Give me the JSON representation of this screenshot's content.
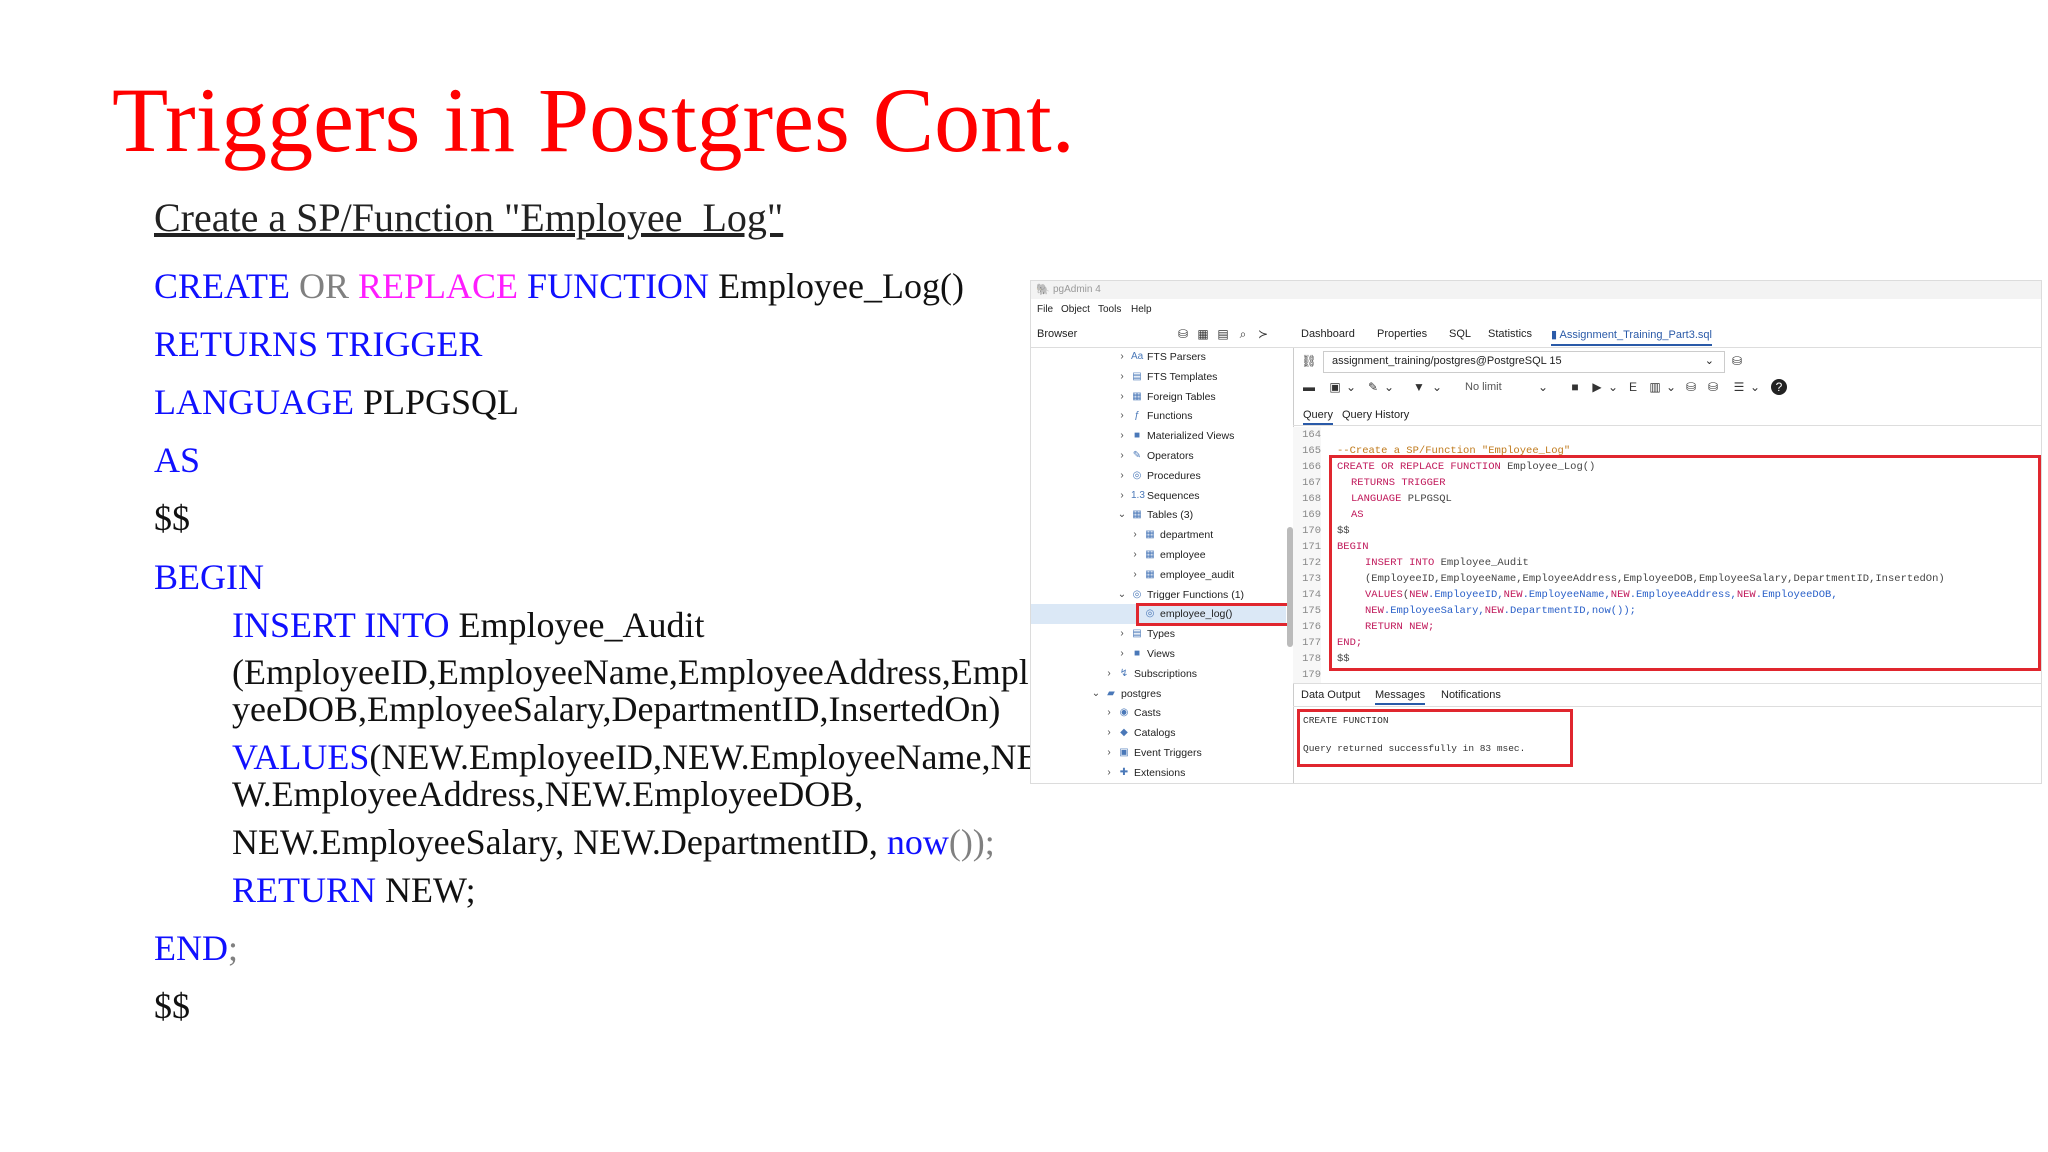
{
  "slide": {
    "title": "Triggers in Postgres Cont.",
    "subtitle": "Create a SP/Function \"Employee_Log\"",
    "code": {
      "l1_create": "CREATE",
      "l1_or": "OR",
      "l1_replace": "REPLACE",
      "l1_function": "FUNCTION",
      "l1_name": "Employee_Log()",
      "l2": "RETURNS TRIGGER",
      "l3_kw": "LANGUAGE",
      "l3_val": "PLPGSQL",
      "l4": "AS",
      "l5": "$$",
      "l6": "BEGIN",
      "l7_kw": "INSERT INTO",
      "l7_name": "Employee_Audit",
      "l8a": "(EmployeeID,EmployeeName,EmployeeAddress,Emplo",
      "l8b": "yeeDOB,EmployeeSalary,DepartmentID,InsertedOn)",
      "l9_kw": "VALUES",
      "l9_rest": "(NEW.EmployeeID,NEW.EmployeeName,NE",
      "l10": "W.EmployeeAddress,NEW.EmployeeDOB,",
      "l11_a": "NEW.EmployeeSalary, NEW.DepartmentID, ",
      "l11_now": "now",
      "l11_b": "());",
      "l12_kw": "RETURN",
      "l12_rest": "NEW;",
      "l13_kw": "END",
      "l13_semi": ";",
      "l14": "$$"
    }
  },
  "pgadmin": {
    "window_title": "pgAdmin 4",
    "menu": [
      "File",
      "Object",
      "Tools",
      "Help"
    ],
    "browser_label": "Browser",
    "tabs": [
      "Dashboard",
      "Properties",
      "SQL",
      "Statistics",
      "Assignment_Training_Part3.sql"
    ],
    "connection": "assignment_training/postgres@PostgreSQL 15",
    "toolbar_limit": "No limit",
    "query_tabs": [
      "Query",
      "Query History"
    ],
    "output_tabs": [
      "Data Output",
      "Messages",
      "Notifications"
    ],
    "tree": [
      {
        "label": "FTS Parsers",
        "icon": "Aa",
        "chev": "›",
        "indent": 0
      },
      {
        "label": "FTS Templates",
        "icon": "▤",
        "chev": "›",
        "indent": 0
      },
      {
        "label": "Foreign Tables",
        "icon": "▦",
        "chev": "›",
        "indent": 0
      },
      {
        "label": "Functions",
        "icon": "ƒ",
        "chev": "›",
        "indent": 0
      },
      {
        "label": "Materialized Views",
        "icon": "■",
        "chev": "›",
        "indent": 0
      },
      {
        "label": "Operators",
        "icon": "✎",
        "chev": "›",
        "indent": 0
      },
      {
        "label": "Procedures",
        "icon": "◎",
        "chev": "›",
        "indent": 0
      },
      {
        "label": "Sequences",
        "icon": "1.3",
        "chev": "›",
        "indent": 0
      },
      {
        "label": "Tables (3)",
        "icon": "▦",
        "chev": "⌄",
        "indent": 0
      },
      {
        "label": "department",
        "icon": "▦",
        "chev": "›",
        "indent": 1
      },
      {
        "label": "employee",
        "icon": "▦",
        "chev": "›",
        "indent": 1
      },
      {
        "label": "employee_audit",
        "icon": "▦",
        "chev": "›",
        "indent": 1
      },
      {
        "label": "Trigger Functions (1)",
        "icon": "◎",
        "chev": "⌄",
        "indent": 0
      },
      {
        "label": "employee_log()",
        "icon": "◎",
        "chev": "",
        "indent": 1
      },
      {
        "label": "Types",
        "icon": "▤",
        "chev": "›",
        "indent": 0
      },
      {
        "label": "Views",
        "icon": "■",
        "chev": "›",
        "indent": 0
      },
      {
        "label": "Subscriptions",
        "icon": "↯",
        "chev": "›",
        "indent": -1
      },
      {
        "label": "postgres",
        "icon": "▰",
        "chev": "⌄",
        "indent": -2
      },
      {
        "label": "Casts",
        "icon": "◉",
        "chev": "›",
        "indent": -1
      },
      {
        "label": "Catalogs",
        "icon": "◆",
        "chev": "›",
        "indent": -1
      },
      {
        "label": "Event Triggers",
        "icon": "▣",
        "chev": "›",
        "indent": -1
      },
      {
        "label": "Extensions",
        "icon": "✚",
        "chev": "›",
        "indent": -1
      }
    ],
    "editor": {
      "line_numbers": [
        "164",
        "165",
        "166",
        "167",
        "168",
        "169",
        "170",
        "171",
        "172",
        "173",
        "174",
        "175",
        "176",
        "177",
        "178",
        "179"
      ],
      "comment": "--Create a SP/Function \"Employee_Log\"",
      "c166_kw": "CREATE OR REPLACE FUNCTION",
      "c166_name": " Employee_Log()",
      "c167": "RETURNS TRIGGER",
      "c168_kw": "LANGUAGE",
      "c168_val": " PLPGSQL",
      "c169": "AS",
      "c170": "$$",
      "c171": "BEGIN",
      "c172_kw": "INSERT INTO",
      "c172_name": " Employee_Audit",
      "c173": "(EmployeeID,EmployeeName,EmployeeAddress,EmployeeDOB,EmployeeSalary,DepartmentID,InsertedOn)",
      "c174_values": "VALUES",
      "c174_paren": "(",
      "c174_n1": "NEW",
      "c174_f1": ".EmployeeID,",
      "c174_n2": "NEW",
      "c174_f2": ".EmployeeName,",
      "c174_n3": "NEW",
      "c174_f3": ".EmployeeAddress,",
      "c174_n4": "NEW",
      "c174_f4": ".EmployeeDOB,",
      "c175_n1": "NEW",
      "c175_f1": ".EmployeeSalary,",
      "c175_n2": "NEW",
      "c175_f2": ".DepartmentID,now());",
      "c176": "RETURN NEW;",
      "c177": "END;",
      "c178": "$$"
    },
    "messages": {
      "line1": "CREATE FUNCTION",
      "line2": "Query returned successfully in 83 msec."
    }
  }
}
